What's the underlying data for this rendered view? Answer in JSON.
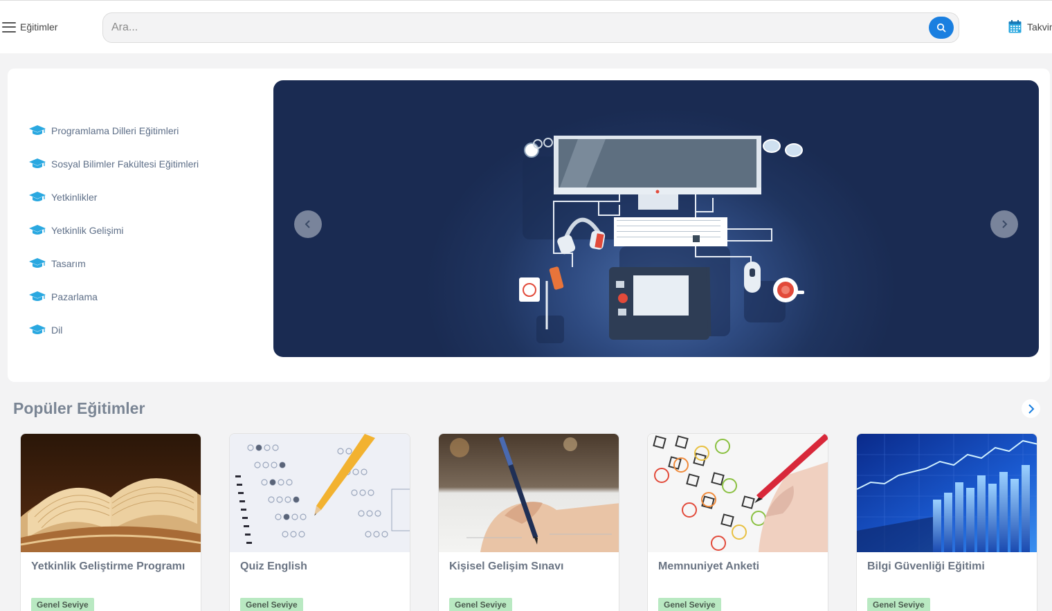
{
  "header": {
    "menu_label": "Eğitimler",
    "search_placeholder": "Ara...",
    "calendar_label": "Takvim"
  },
  "categories": [
    {
      "label": "Programlama Dilleri Eğitimleri",
      "icon": "graduation-cap-icon"
    },
    {
      "label": "Sosyal Bilimler Fakültesi Eğitimleri",
      "icon": "graduation-cap-icon"
    },
    {
      "label": "Yetkinlikler",
      "icon": "graduation-cap-icon"
    },
    {
      "label": "Yetkinlik Gelişimi",
      "icon": "graduation-cap-icon"
    },
    {
      "label": "Tasarım",
      "icon": "graduation-cap-icon"
    },
    {
      "label": "Pazarlama",
      "icon": "graduation-cap-icon"
    },
    {
      "label": "Dil",
      "icon": "graduation-cap-icon"
    }
  ],
  "slider": {
    "prev_icon": "chevron-left-icon",
    "next_icon": "chevron-right-icon"
  },
  "popular": {
    "title": "Popüler Eğitimler",
    "next_icon": "chevron-right-icon",
    "cards": [
      {
        "title": "Yetkinlik Geliştirme Programı",
        "badge": "Genel Seviye",
        "image": "open-book"
      },
      {
        "title": "Quiz English",
        "badge": "Genel Seviye",
        "image": "answer-sheet-pencil"
      },
      {
        "title": "Kişisel Gelişim Sınavı",
        "badge": "Genel Seviye",
        "image": "hand-writing"
      },
      {
        "title": "Memnuniyet Anketi",
        "badge": "Genel Seviye",
        "image": "satisfaction-survey"
      },
      {
        "title": "Bilgi Güvenliği Eğitimi",
        "badge": "Genel Seviye",
        "image": "data-chart"
      }
    ]
  },
  "colors": {
    "accent": "#1a7fe0",
    "category_icon": "#2aa8e0",
    "badge_bg": "#b9e9c2",
    "slider_bg": "#1f345f"
  }
}
